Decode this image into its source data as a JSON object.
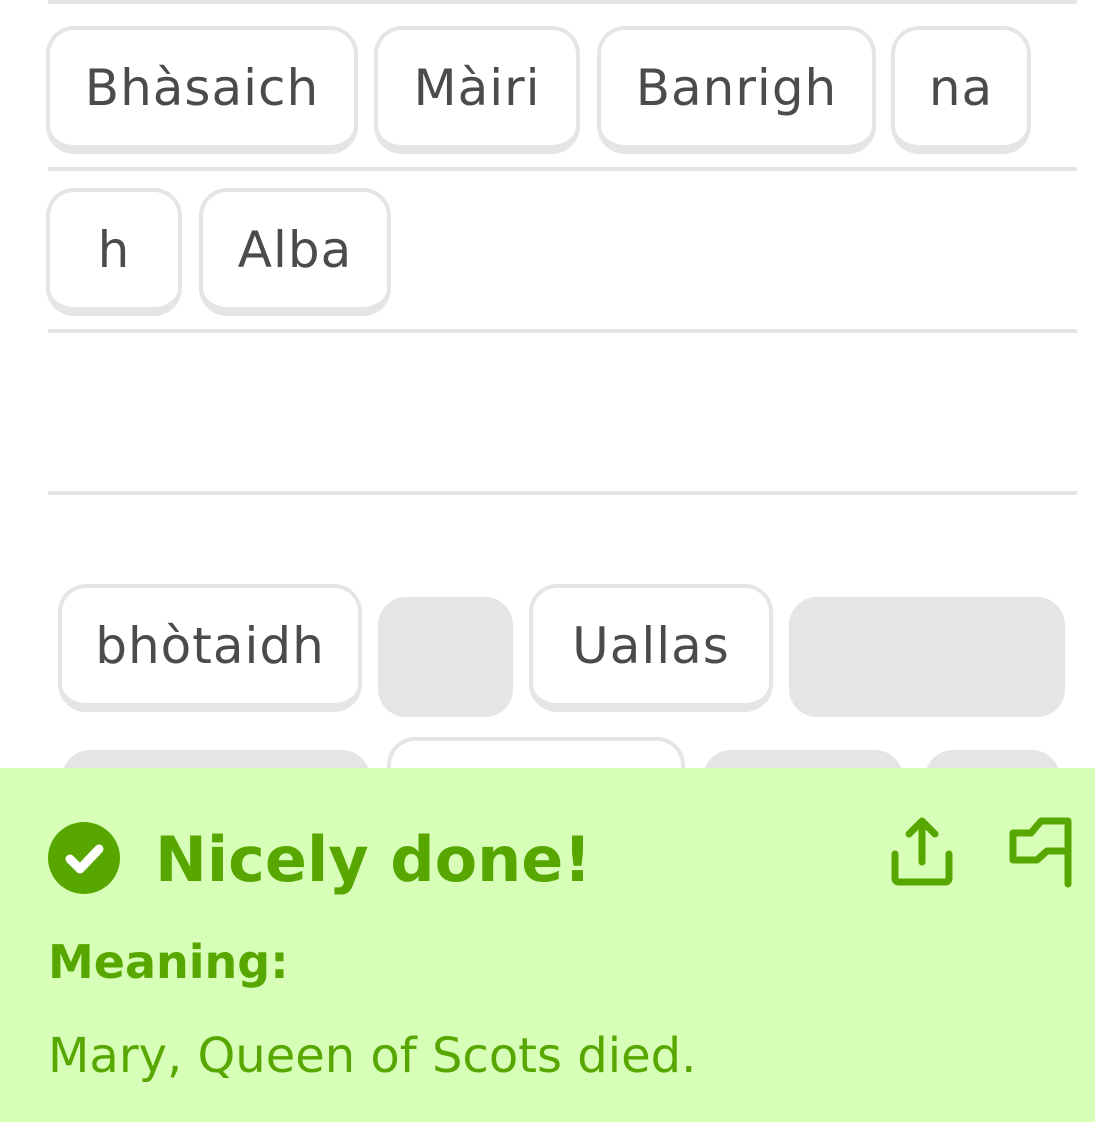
{
  "answer_tiles": [
    "Bhàsaich",
    "Màiri",
    "Banrigh",
    "na",
    "h",
    "Alba"
  ],
  "word_bank": [
    "bhòtaidh",
    "Uallas"
  ],
  "feedback": {
    "title": "Nicely done!",
    "meaning_label": "Meaning:",
    "meaning_text": "Mary, Queen of Scots died."
  },
  "icons": {
    "status": "check-circle-icon",
    "share": "share-icon",
    "report": "flag-icon"
  },
  "colors": {
    "success_background": "#d7ffb8",
    "success_text": "#58a700",
    "tile_border": "#e5e5e5",
    "tile_text": "#4b4b4b",
    "used_slot": "#e5e5e5"
  }
}
